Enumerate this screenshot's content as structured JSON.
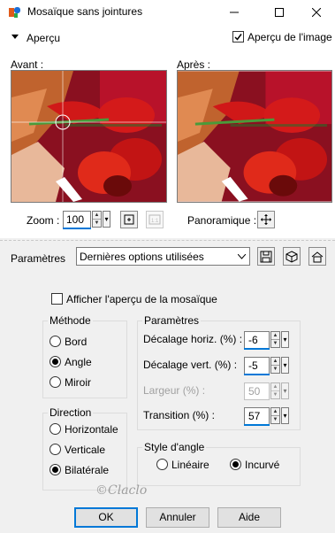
{
  "window": {
    "title": "Mosaïque sans jointures"
  },
  "preview_section": {
    "label": "Aperçu",
    "show_image_preview_label": "Aperçu de l'image",
    "show_image_preview_checked": true,
    "before_label": "Avant :",
    "after_label": "Après :",
    "zoom_label": "Zoom :",
    "zoom_value": "100",
    "pan_label": "Panoramique :"
  },
  "presets": {
    "label": "Paramètres",
    "selected": "Dernières options utilisées"
  },
  "mosaic_preview": {
    "label": "Afficher l'aperçu de la mosaïque",
    "checked": false
  },
  "method": {
    "title": "Méthode",
    "options": [
      "Bord",
      "Angle",
      "Miroir"
    ],
    "selected": "Angle"
  },
  "direction": {
    "title": "Direction",
    "options": [
      "Horizontale",
      "Verticale",
      "Bilatérale"
    ],
    "selected": "Bilatérale"
  },
  "params": {
    "title": "Paramètres",
    "h_offset_label": "Décalage horiz. (%) :",
    "h_offset_value": "-6",
    "v_offset_label": "Décalage vert. (%) :",
    "v_offset_value": "-5",
    "width_label": "Largeur (%) :",
    "width_value": "50",
    "transition_label": "Transition (%) :",
    "transition_value": "57"
  },
  "corner_style": {
    "title": "Style d'angle",
    "options": [
      "Linéaire",
      "Incurvé"
    ],
    "selected": "Incurvé"
  },
  "buttons": {
    "ok": "OK",
    "cancel": "Annuler",
    "help": "Aide"
  },
  "watermark": "©Claclo"
}
